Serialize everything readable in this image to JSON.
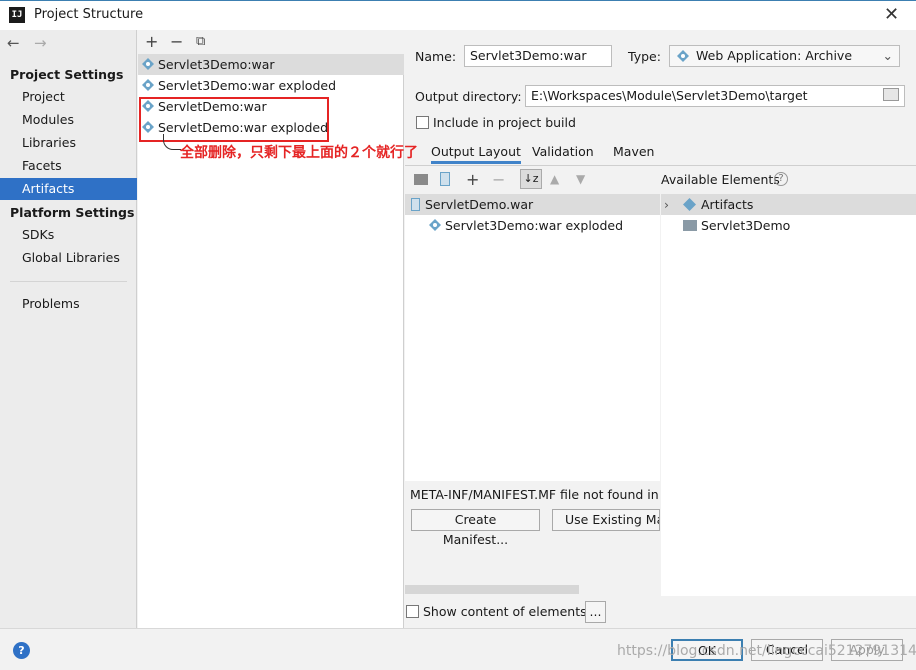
{
  "window": {
    "title": "Project Structure"
  },
  "nav": {
    "project_settings": "Project Settings",
    "project_items": [
      "Project",
      "Modules",
      "Libraries",
      "Facets",
      "Artifacts"
    ],
    "platform_settings": "Platform Settings",
    "platform_items": [
      "SDKs",
      "Global Libraries"
    ],
    "problems": "Problems",
    "selected": "Artifacts"
  },
  "artifacts": [
    "Servlet3Demo:war",
    "Servlet3Demo:war exploded",
    "ServletDemo:war",
    "ServletDemo:war exploded"
  ],
  "annotation": "全部删除，只剩下最上面的２个就行了",
  "form": {
    "name_label": "Name:",
    "name_value": "Servlet3Demo:war",
    "type_label": "Type:",
    "type_value": "Web Application: Archive",
    "output_label": "Output directory:",
    "output_value": "E:\\Workspaces\\Module\\Servlet3Demo\\target",
    "include_label": "Include in project build"
  },
  "tabs": [
    "Output Layout",
    "Validation",
    "Maven"
  ],
  "layout_tree": [
    "ServletDemo.war",
    "Servlet3Demo:war exploded"
  ],
  "available": {
    "title": "Available Elements",
    "items": [
      "Artifacts",
      "Servlet3Demo"
    ]
  },
  "manifest": {
    "message": "META-INF/MANIFEST.MF file not found in '",
    "create_label": "Create Manifest...",
    "existing_label": "Use Existing Ma"
  },
  "show_content_label": "Show content of elements",
  "ellipsis_label": "...",
  "buttons": {
    "ok": "OK",
    "cancel": "Cancel",
    "apply": "Apply"
  },
  "watermark": "https://blog.csdn.net/lingcccai5212791314",
  "colors": {
    "selection": "#2f71c6",
    "annotation": "#e52424",
    "tab_underline": "#4083c9"
  }
}
